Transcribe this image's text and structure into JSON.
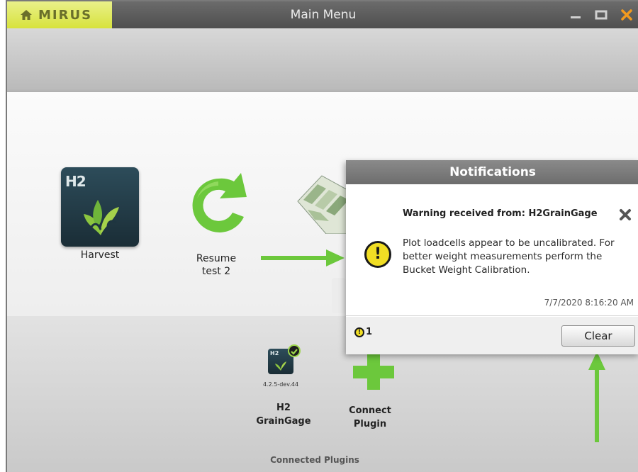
{
  "window": {
    "brand": "MIRUS",
    "title": "Main Menu"
  },
  "apps": [
    {
      "label": "Harvest",
      "icon": "h2-leaf-icon",
      "icon_text": "H2"
    },
    {
      "label_line1": "Resume",
      "label_line2": "test 2",
      "icon": "resume-refresh-icon"
    }
  ],
  "notifications": {
    "title": "Notifications",
    "warning_from": "Warning received from: H2GrainGage",
    "message": "Plot loadcells appear to be uncalibrated. For better weight measurements perform the Bucket Weight Calibration.",
    "timestamp": "7/7/2020 8:16:20 AM",
    "count": "1",
    "clear_label": "Clear"
  },
  "plugins": {
    "h2": {
      "version": "4.2.5-dev.44",
      "name_line1": "H2",
      "name_line2": "GrainGage",
      "icon_text": "H2"
    },
    "connect": {
      "name_line1": "Connect",
      "name_line2": "Plugin"
    },
    "section_label": "Connected Plugins"
  },
  "colors": {
    "brand_bg": "#d7e23c",
    "accent_green": "#6cc83c",
    "warning_yellow": "#f1de24",
    "close_orange": "#f39a1e"
  }
}
